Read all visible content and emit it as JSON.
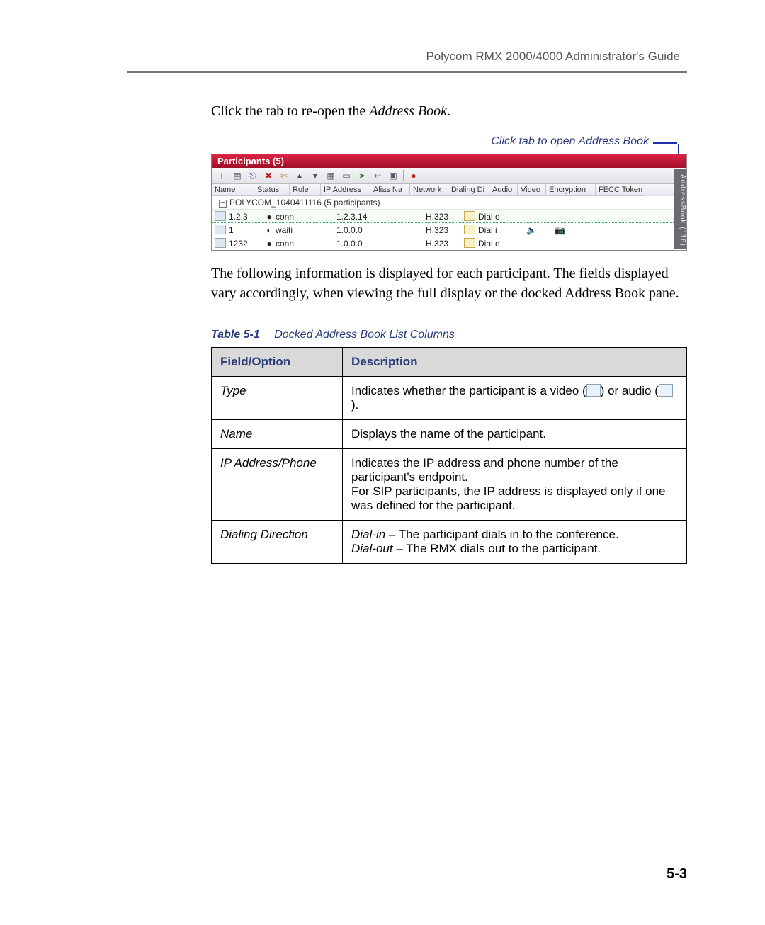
{
  "header": {
    "title": "Polycom RMX 2000/4000 Administrator's Guide"
  },
  "intro1_a": "Click the tab to re-open the ",
  "intro1_b": "Address Book",
  "intro1_c": ".",
  "caption_arrow": "Click tab to open Address Book",
  "app": {
    "titlebar": "Participants (5)",
    "side_tab": "AddressBook (116)",
    "toolbar_icons": [
      "add-participant",
      "document",
      "link",
      "x",
      "cut",
      "up",
      "down",
      "clipboard",
      "card",
      "arrow",
      "back",
      "window",
      "record"
    ],
    "columns": [
      "Name",
      "Status",
      "Role",
      "IP Address",
      "Alias Na",
      "Network",
      "Dialing Di",
      "Audio",
      "Video",
      "Encryption",
      "FECC Token"
    ],
    "group": "POLYCOM_1040411116 (5 participants)",
    "rows": [
      {
        "name": "1.2.3",
        "status": "conn",
        "status_icon": "●",
        "ip": "1.2.3.14",
        "network": "H.323",
        "dial": "Dial o",
        "audio": "",
        "video": "",
        "selected": true
      },
      {
        "name": "1",
        "status": "waiti",
        "status_icon": "◐",
        "ip": "1.0.0.0",
        "network": "H.323",
        "dial": "Dial i",
        "audio": "🔈",
        "video": "📷",
        "selected": false
      },
      {
        "name": "1232",
        "status": "conn",
        "status_icon": "●",
        "ip": "1.0.0.0",
        "network": "H.323",
        "dial": "Dial o",
        "audio": "",
        "video": "",
        "selected": false
      }
    ]
  },
  "intro2": "The following information is displayed for each participant. The fields displayed vary accordingly, when viewing the full display or the docked Address Book pane.",
  "table": {
    "number": "Table 5-1",
    "title": "Docked Address Book List Columns",
    "head_field": "Field/Option",
    "head_desc": "Description",
    "rows": [
      {
        "field": "Type",
        "desc_parts": {
          "a": "Indicates whether the participant is a video (",
          "b": ") or audio (",
          "c": ")."
        }
      },
      {
        "field": "Name",
        "desc": "Displays the name of the participant."
      },
      {
        "field": "IP Address/Phone",
        "desc": "Indicates the IP address and phone number of the participant's endpoint.\nFor SIP participants, the IP address is displayed only if one was defined for the participant."
      },
      {
        "field": "Dialing Direction",
        "desc_rich": {
          "di": "Dial-in",
          "di_t": " – The participant dials in to the conference.",
          "do": "Dial-out",
          "do_t": " – The RMX dials out to the participant."
        }
      }
    ]
  },
  "page_number": "5-3"
}
